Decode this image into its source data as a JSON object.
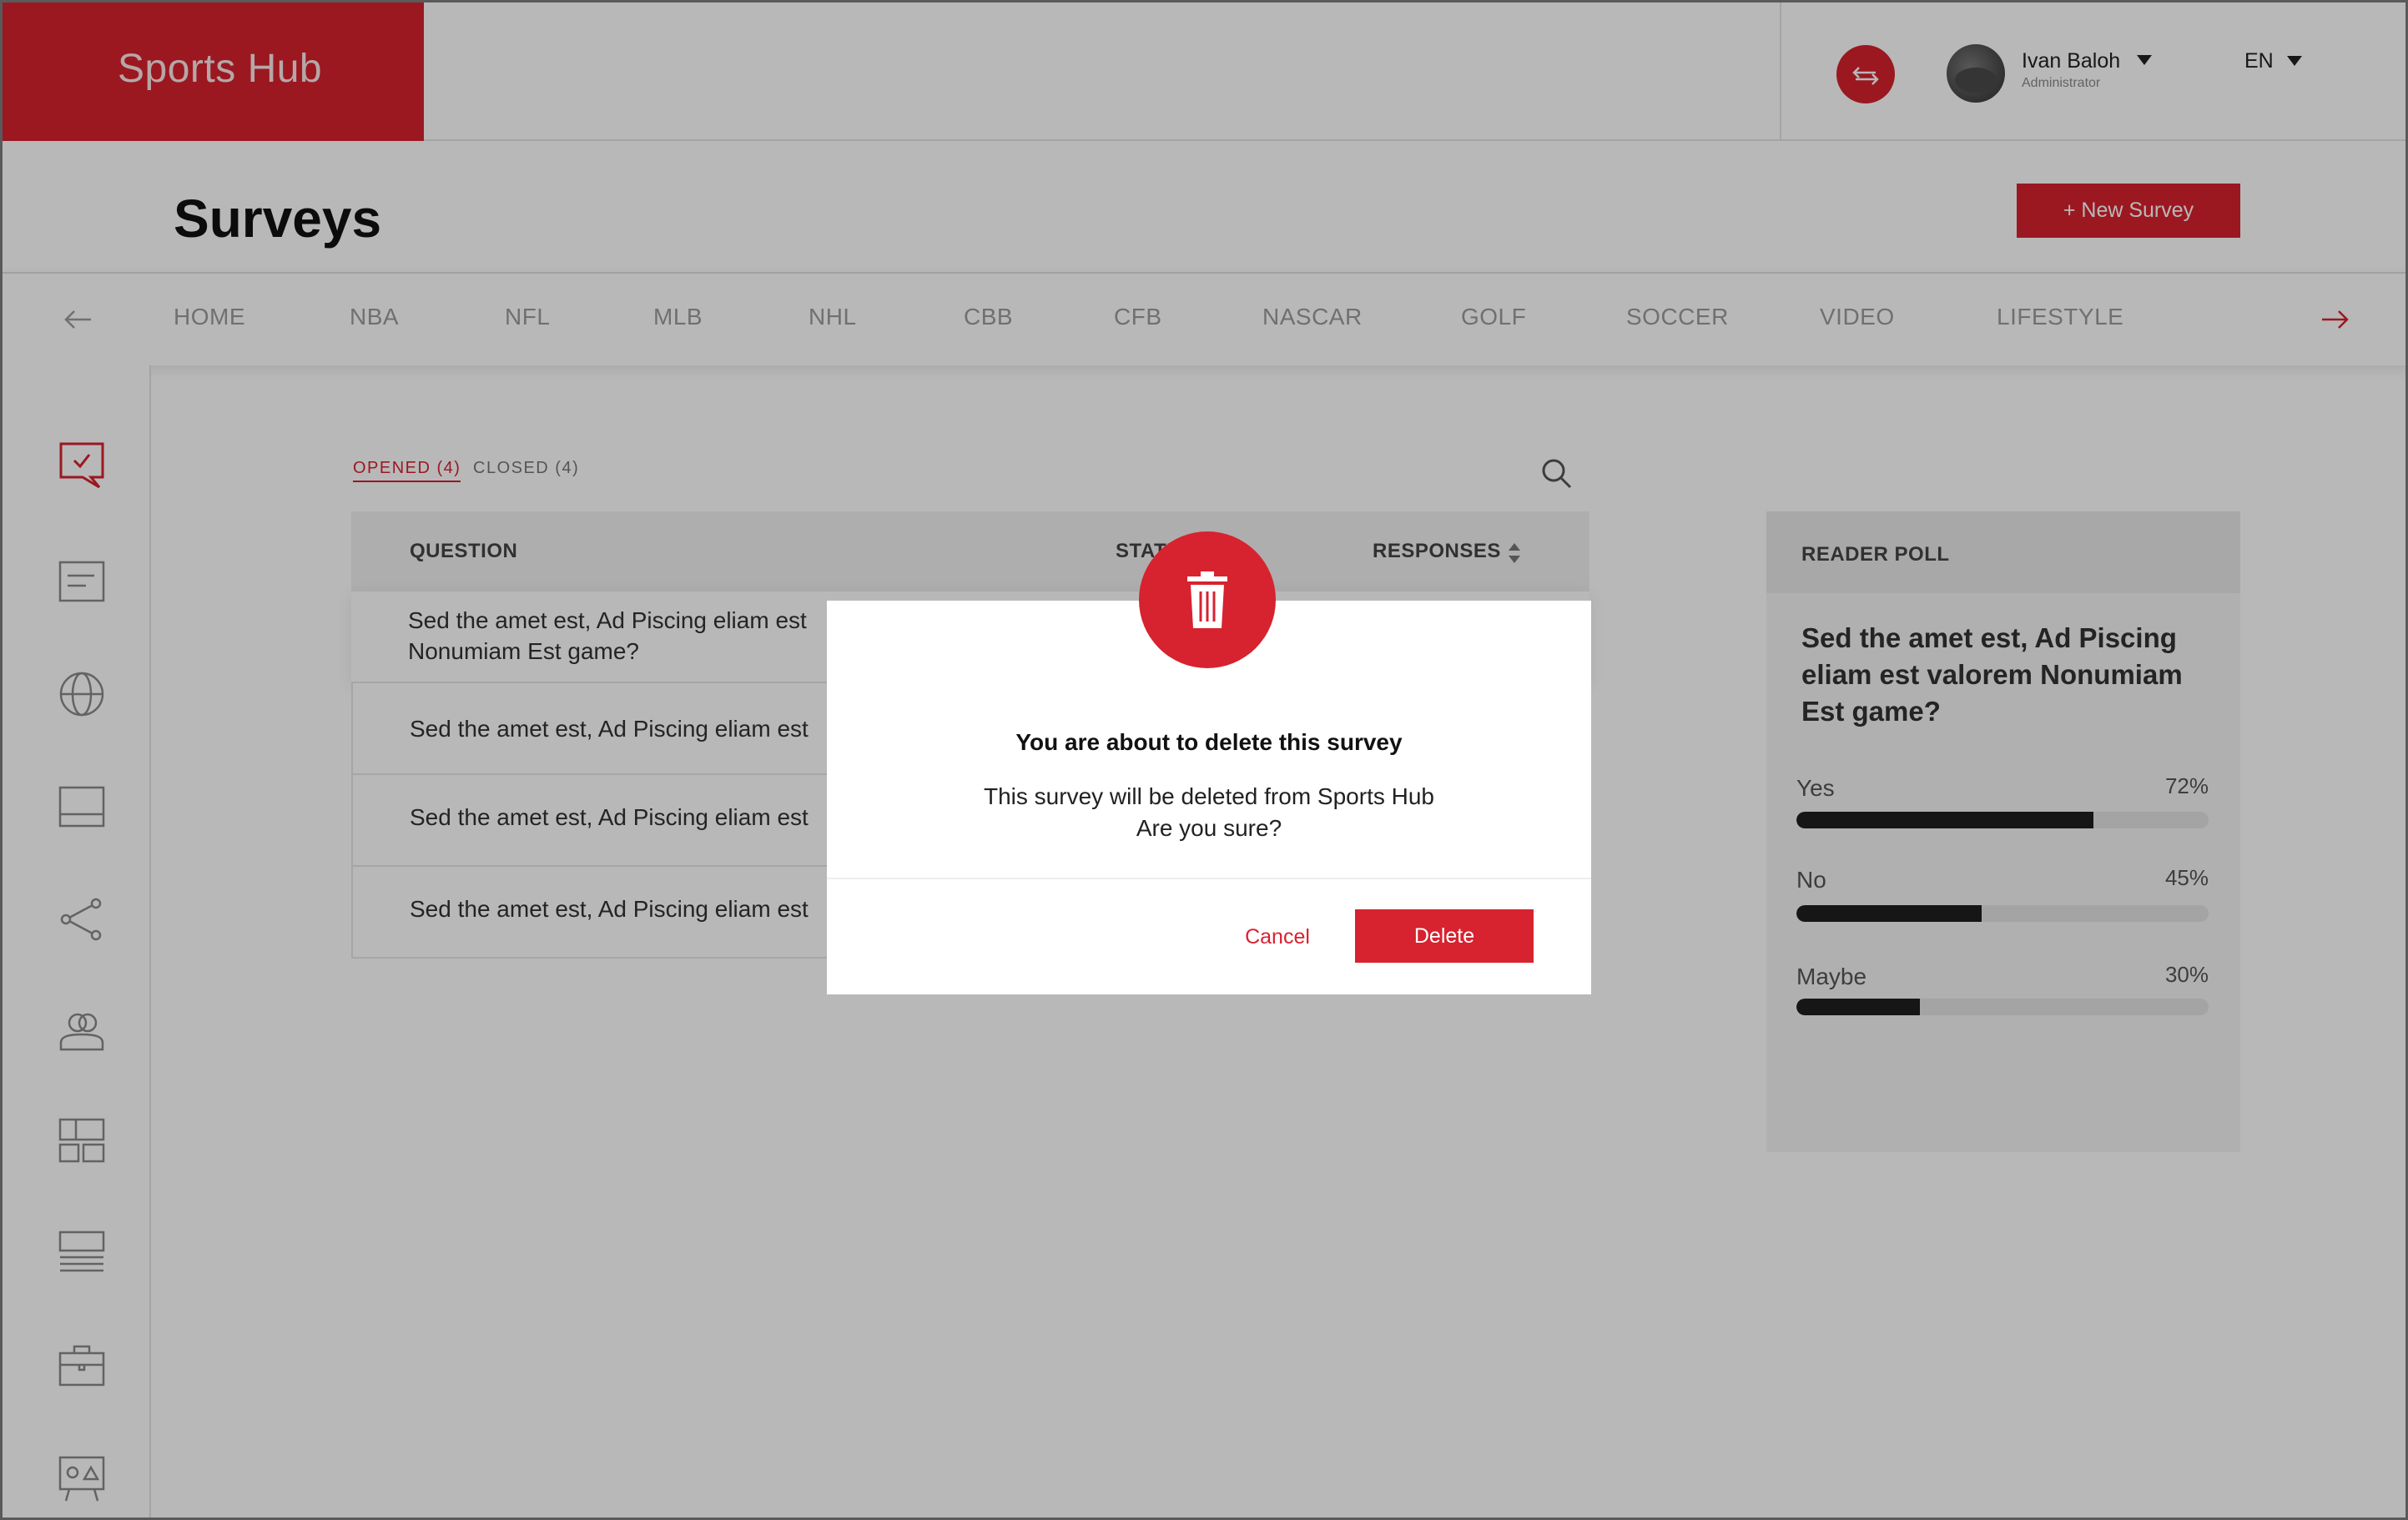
{
  "app": {
    "title": "Sports Hub"
  },
  "header": {
    "user_name": "Ivan Baloh",
    "user_role": "Administrator",
    "language": "EN"
  },
  "page": {
    "title": "Surveys",
    "new_button_label": "+ New Survey"
  },
  "categories": [
    "HOME",
    "NBA",
    "NFL",
    "MLB",
    "NHL",
    "CBB",
    "CFB",
    "NASCAR",
    "GOLF",
    "SOCCER",
    "VIDEO",
    "LIFESTYLE"
  ],
  "tabs": {
    "opened": "OPENED (4)",
    "closed": "CLOSED (4)"
  },
  "table": {
    "columns": {
      "question": "QUESTION",
      "status": "STATUS",
      "responses": "RESPONSES"
    },
    "rows": [
      {
        "question": "Sed the amet est, Ad Piscing eliam est\nNonumiam Est game?"
      },
      {
        "question": "Sed the amet est, Ad Piscing eliam est"
      },
      {
        "question": "Sed the amet est, Ad Piscing eliam est"
      },
      {
        "question": "Sed the amet est, Ad Piscing eliam est"
      }
    ]
  },
  "reader_poll": {
    "title": "READER POLL",
    "question": "Sed the amet est, Ad Piscing eliam est valorem Nonumiam Est game?",
    "options": [
      {
        "label": "Yes",
        "percent_text": "72%",
        "value": 72
      },
      {
        "label": "No",
        "percent_text": "45%",
        "value": 45
      },
      {
        "label": "Maybe",
        "percent_text": "30%",
        "value": 30
      }
    ]
  },
  "modal": {
    "title": "You are about to delete this survey",
    "message_line1": "This survey will be deleted from Sports Hub",
    "message_line2": "Are you sure?",
    "cancel_label": "Cancel",
    "delete_label": "Delete"
  },
  "colors": {
    "brand": "#d7222f",
    "text_dark": "#1d1d1d",
    "muted": "#9b9b9b"
  },
  "icons": {
    "sidebar": [
      "survey-icon",
      "article-icon",
      "globe-icon",
      "panel-icon",
      "share-icon",
      "users-icon",
      "layout-icon",
      "list-icon",
      "briefcase-icon",
      "media-icon"
    ]
  }
}
